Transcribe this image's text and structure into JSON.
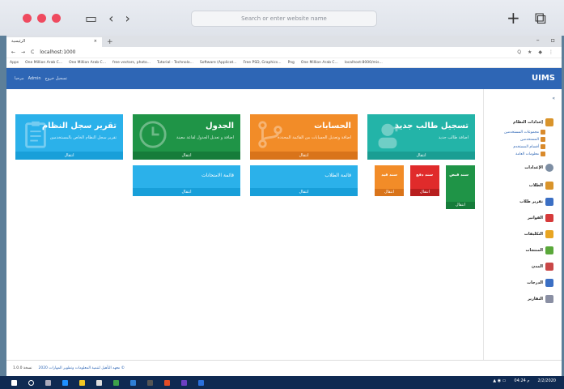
{
  "mac": {
    "search_placeholder": "Search or enter website name"
  },
  "browser": {
    "tab_title": "الرئيسية",
    "url": "localhost:1000",
    "bookmarks": [
      "Apps",
      "One Million Arab C...",
      "One Million Arab C...",
      "free vectors, photo...",
      "Tutorial - Technolo...",
      "Software (Applicat...",
      "Free PSD, Graphics...",
      "Png",
      "One Million Arab C...",
      "localhost:8000/mis..."
    ]
  },
  "header": {
    "links": [
      "مرحبا",
      "Admin",
      "تسجيل خروج"
    ],
    "logo": "UIMS"
  },
  "cards": {
    "register": {
      "title": "تسجيل طالب جديد",
      "sub": "اضافة طالب جديد",
      "foot": "انتقال"
    },
    "accounts": {
      "title": "الحسابات",
      "sub": "اضافة وتعديل الحسابات من القائمة المحددة",
      "foot": "انتقال"
    },
    "schedule": {
      "title": "الجدول",
      "sub": "اضافة و تعديل الجدول لقاعة معينة",
      "foot": "انتقال"
    },
    "syslog": {
      "title": "تقرير سجل النظام",
      "sub": "تقرير سجل النظام الخاص بالمستخدمين",
      "foot": "انتقال"
    },
    "students": {
      "title": "قائمة الطلاب",
      "foot": "انتقال"
    },
    "exams": {
      "title": "قائمة الامتحانات",
      "foot": "انتقال"
    },
    "receipt": {
      "title": "سند قبض",
      "foot": "انتقال"
    },
    "payment": {
      "title": "سند دفع",
      "foot": "انتقال"
    },
    "restriction": {
      "title": "سند قيد",
      "foot": "انتقال"
    }
  },
  "sidebar": {
    "items": [
      {
        "label": "إعدادات النظام"
      },
      {
        "label": "الإعدادات"
      },
      {
        "label": "الطلاب"
      },
      {
        "label": "تقرير طلاب"
      },
      {
        "label": "الفواتير"
      },
      {
        "label": "التكليفات"
      },
      {
        "label": "المنتجات"
      },
      {
        "label": "المدن"
      },
      {
        "label": "الدرجات"
      },
      {
        "label": "التقارير"
      }
    ],
    "subitems": [
      {
        "label": "مجموعات المستخدمين"
      },
      {
        "label": "المستخدمين"
      },
      {
        "label": "أقسام المستخدم"
      },
      {
        "label": "معلومات العامة"
      }
    ]
  },
  "footer": {
    "copyright": "معهد التأهيل لتنمية المعلومات وتطوير المهارات 2020 ©",
    "version": "نسخة 1.0.0"
  },
  "taskbar": {
    "time": "04:24 م",
    "date": "2/2/2020"
  }
}
